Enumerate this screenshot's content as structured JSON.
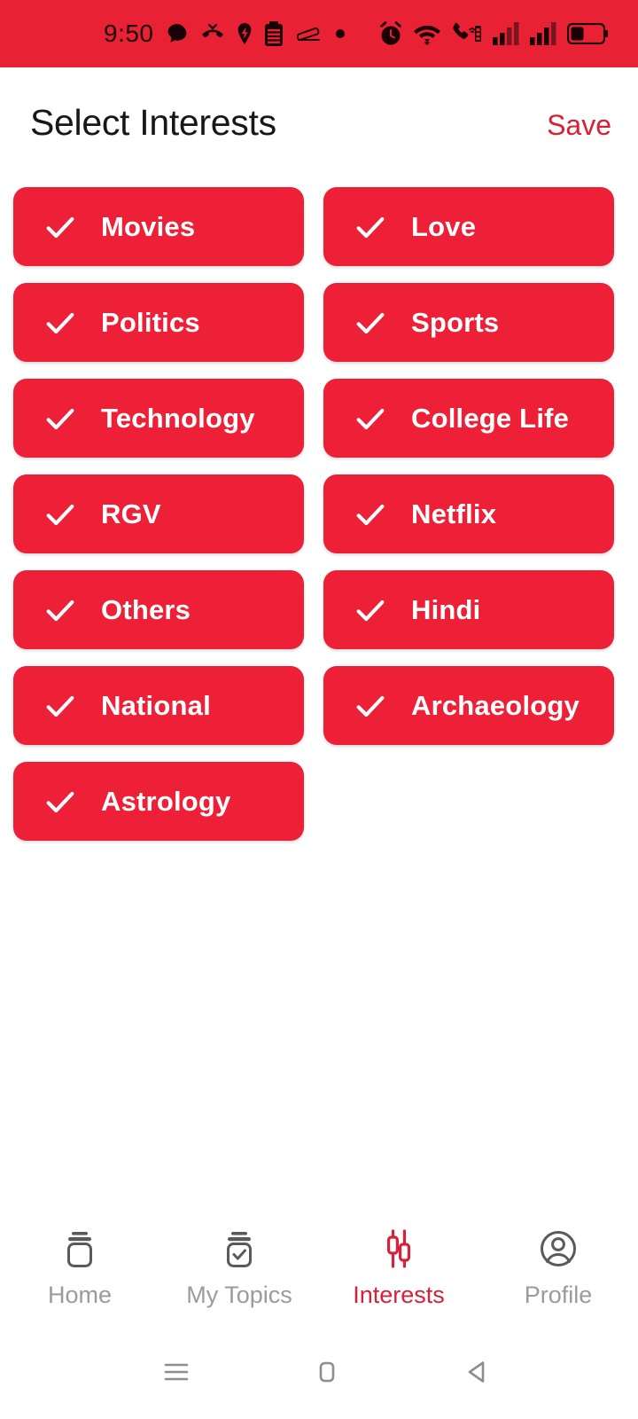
{
  "statusbar": {
    "time": "9:50",
    "left_icons": [
      "chat-bubble-icon",
      "missed-call-icon",
      "location-pin-icon",
      "battery-saver-icon",
      "sofa-icon",
      "dot-icon"
    ],
    "right_icons": [
      "alarm-icon",
      "wifi-icon",
      "call-signal-icon",
      "signal-bars-sim1-icon",
      "signal-bars-sim2-icon",
      "battery-icon"
    ],
    "background": "#E82134",
    "icon_color": "#1a0306"
  },
  "header": {
    "title": "Select Interests",
    "save_label": "Save",
    "title_color": "#15171a",
    "save_color": "#DA2035"
  },
  "interests": {
    "chip_color": "#EE2037",
    "chip_text_color": "#FFFFFF",
    "check_icon": "check-icon",
    "items": [
      {
        "label": "Movies",
        "selected": true
      },
      {
        "label": "Love",
        "selected": true
      },
      {
        "label": "Politics",
        "selected": true
      },
      {
        "label": "Sports",
        "selected": true
      },
      {
        "label": "Technology",
        "selected": true
      },
      {
        "label": "College Life",
        "selected": true
      },
      {
        "label": "RGV",
        "selected": true
      },
      {
        "label": "Netflix",
        "selected": true
      },
      {
        "label": "Others",
        "selected": true
      },
      {
        "label": "Hindi",
        "selected": true
      },
      {
        "label": "National",
        "selected": true
      },
      {
        "label": "Archaeology",
        "selected": true
      },
      {
        "label": "Astrology",
        "selected": true
      }
    ]
  },
  "tabbar": {
    "active_color": "#D8203A",
    "inactive_color": "#9b9b9b",
    "tabs": [
      {
        "label": "Home",
        "icon": "newspaper-icon",
        "active": false
      },
      {
        "label": "My Topics",
        "icon": "newspaper-check-icon",
        "active": false
      },
      {
        "label": "Interests",
        "icon": "tune-sliders-icon",
        "active": true
      },
      {
        "label": "Profile",
        "icon": "account-circle-icon",
        "active": false
      }
    ]
  },
  "navbar": {
    "buttons": [
      {
        "name": "recents-icon"
      },
      {
        "name": "home-icon"
      },
      {
        "name": "back-icon"
      }
    ]
  }
}
